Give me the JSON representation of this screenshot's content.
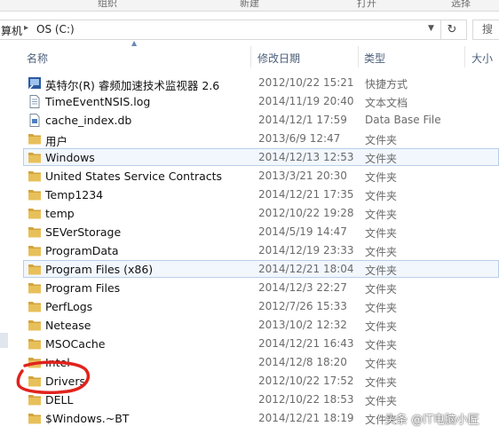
{
  "ribbon": {
    "groups": [
      "组织",
      "新建",
      "打开",
      "选择"
    ]
  },
  "address_bar": {
    "segments": [
      "算机",
      "OS (C:)"
    ],
    "refresh_icon": "refresh-icon",
    "search_placeholder": "搜"
  },
  "columns": {
    "name": "名称",
    "date": "修改日期",
    "type": "类型",
    "size": "大小"
  },
  "files": [
    {
      "name": "英特尔(R) 睿频加速技术监视器 2.6",
      "date": "2012/10/22 15:21",
      "type": "快捷方式",
      "icon": "shortcut-icon"
    },
    {
      "name": "TimeEventNSIS.log",
      "date": "2014/11/19 20:40",
      "type": "文本文档",
      "icon": "text-file-icon"
    },
    {
      "name": "cache_index.db",
      "date": "2014/12/1 17:59",
      "type": "Data Base File",
      "icon": "database-file-icon"
    },
    {
      "name": "用户",
      "date": "2013/6/9 12:47",
      "type": "文件夹",
      "icon": "folder-icon"
    },
    {
      "name": "Windows",
      "date": "2014/12/13 12:53",
      "type": "文件夹",
      "icon": "folder-icon"
    },
    {
      "name": "United States Service Contracts",
      "date": "2013/3/21 20:30",
      "type": "文件夹",
      "icon": "folder-icon"
    },
    {
      "name": "Temp1234",
      "date": "2014/12/21 17:35",
      "type": "文件夹",
      "icon": "folder-icon"
    },
    {
      "name": "temp",
      "date": "2012/10/22 19:28",
      "type": "文件夹",
      "icon": "folder-icon"
    },
    {
      "name": "SEVerStorage",
      "date": "2014/5/19 14:47",
      "type": "文件夹",
      "icon": "folder-icon"
    },
    {
      "name": "ProgramData",
      "date": "2014/12/19 23:33",
      "type": "文件夹",
      "icon": "folder-icon"
    },
    {
      "name": "Program Files (x86)",
      "date": "2014/12/21 18:04",
      "type": "文件夹",
      "icon": "folder-icon"
    },
    {
      "name": "Program Files",
      "date": "2014/12/3 22:27",
      "type": "文件夹",
      "icon": "folder-icon"
    },
    {
      "name": "PerfLogs",
      "date": "2012/7/26 15:33",
      "type": "文件夹",
      "icon": "folder-icon"
    },
    {
      "name": "Netease",
      "date": "2013/10/2 12:32",
      "type": "文件夹",
      "icon": "folder-icon"
    },
    {
      "name": "MSOCache",
      "date": "2014/12/21 16:43",
      "type": "文件夹",
      "icon": "folder-icon"
    },
    {
      "name": "Intel",
      "date": "2014/12/8 18:20",
      "type": "文件夹",
      "icon": "folder-icon"
    },
    {
      "name": "Drivers",
      "date": "2012/10/22 17:52",
      "type": "文件夹",
      "icon": "folder-icon"
    },
    {
      "name": "DELL",
      "date": "2012/10/22 18:53",
      "type": "文件夹",
      "icon": "folder-icon"
    },
    {
      "name": "$Windows.~BT",
      "date": "2014/12/21 18:19",
      "type": "文件夹",
      "icon": "folder-icon"
    }
  ],
  "watermark": "头条 @IT电脑小匠",
  "colors": {
    "folder": "#e8c05a",
    "folder_dark": "#d3a43b",
    "selection_border": "#b8cfe8",
    "annotation_red": "#e0231c"
  }
}
